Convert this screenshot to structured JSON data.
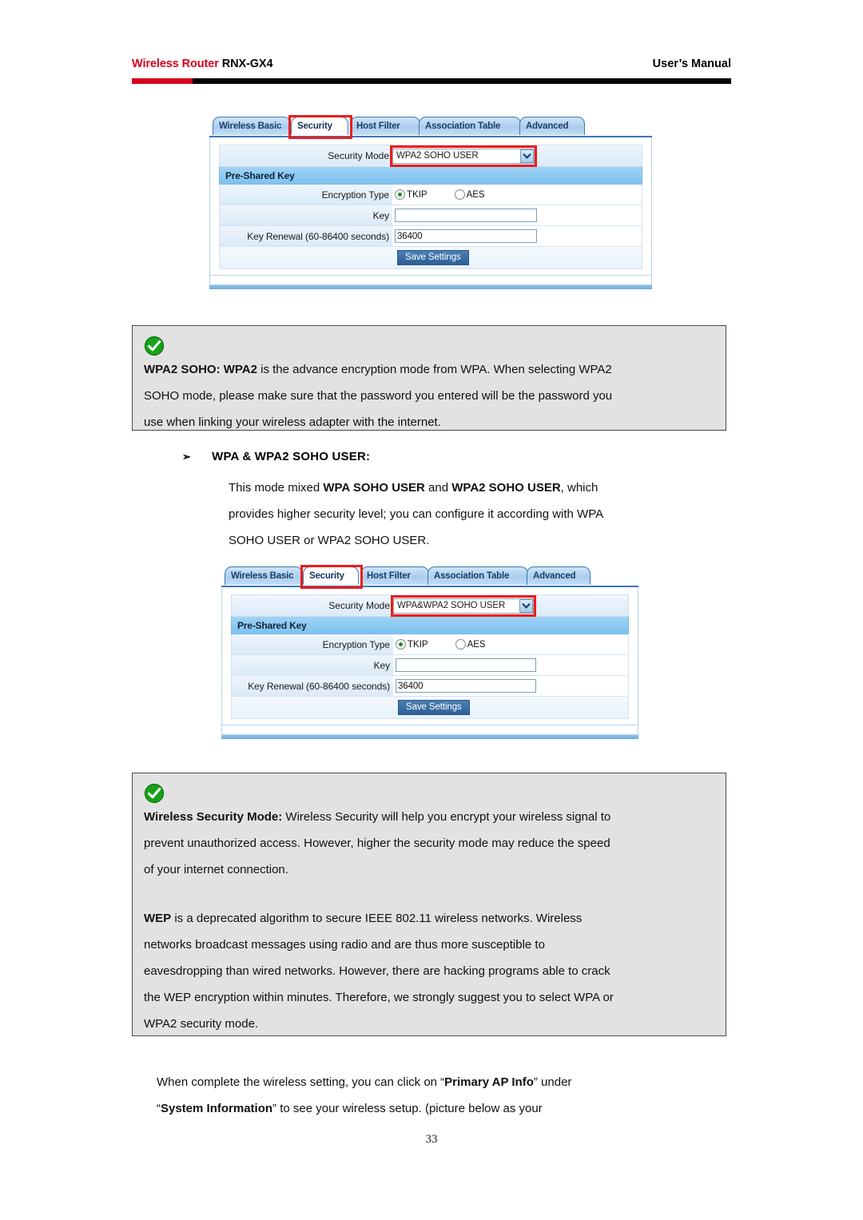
{
  "header": {
    "brand": "Wireless Router",
    "model": "RNX-GX4",
    "right": "User’s Manual"
  },
  "router_ui_1": {
    "tabs": [
      {
        "label": "Wireless Basic",
        "active": false
      },
      {
        "label": "Security",
        "active": true
      },
      {
        "label": "Host Filter",
        "active": false
      },
      {
        "label": "Association Table",
        "active": false
      },
      {
        "label": "Advanced",
        "active": false
      }
    ],
    "security_mode_label": "Security Mode",
    "security_mode_value": "WPA2 SOHO USER",
    "section_title": "Pre-Shared Key",
    "encryption_label": "Encryption Type",
    "encryption_options": [
      {
        "label": "TKIP",
        "selected": true
      },
      {
        "label": "AES",
        "selected": false
      }
    ],
    "key_label": "Key",
    "key_value": "",
    "renewal_label": "Key Renewal (60-86400 seconds)",
    "renewal_value": "36400",
    "save_label": "Save Settings"
  },
  "note_1": {
    "icon": "green-check-icon",
    "lines": [
      {
        "bold": "WPA2 SOHO: WPA2",
        "rest": " is the advance encryption mode from WPA. When selecting WPA2"
      },
      {
        "bold": "",
        "rest": "SOHO mode, please make sure that the password you entered will be the password you"
      },
      {
        "bold": "",
        "rest": "use when linking your wireless adapter with the internet."
      }
    ]
  },
  "section": {
    "arrow": "➢",
    "heading": "WPA & WPA2 SOHO USER:",
    "body_line1_a": "This mode mixed ",
    "body_line1_b": "WPA SOHO USER",
    "body_line1_c": " and ",
    "body_line1_d": "WPA2 SOHO USER",
    "body_line1_e": ", which",
    "body_line2": "provides higher security level; you can configure it according with WPA",
    "body_line3": "SOHO USER or WPA2 SOHO USER."
  },
  "router_ui_2": {
    "tabs": [
      {
        "label": "Wireless Basic",
        "active": false
      },
      {
        "label": "Security",
        "active": true
      },
      {
        "label": "Host Filter",
        "active": false
      },
      {
        "label": "Association Table",
        "active": false
      },
      {
        "label": "Advanced",
        "active": false
      }
    ],
    "security_mode_label": "Security Mode",
    "security_mode_value": "WPA&WPA2 SOHO USER",
    "section_title": "Pre-Shared Key",
    "encryption_label": "Encryption Type",
    "encryption_options": [
      {
        "label": "TKIP",
        "selected": true
      },
      {
        "label": "AES",
        "selected": false
      }
    ],
    "key_label": "Key",
    "key_value": "",
    "renewal_label": "Key Renewal (60-86400 seconds)",
    "renewal_value": "36400",
    "save_label": "Save Settings"
  },
  "note_2": {
    "icon": "green-check-icon",
    "p1_bold": "Wireless Security Mode:",
    "p1_l1": " Wireless Security will help you encrypt your wireless signal to",
    "p1_l2": "prevent unauthorized access. However, higher the security mode may reduce the speed",
    "p1_l3": "of your internet connection.",
    "p2_bold": "WEP",
    "p2_l1": " is a deprecated algorithm to secure IEEE 802.11 wireless networks. Wireless",
    "p2_l2": "networks broadcast messages using radio and are thus more susceptible to",
    "p2_l3": "eavesdropping than wired networks. However, there are hacking programs able to crack",
    "p2_l4": "the WEP encryption within minutes. Therefore, we strongly suggest you to select WPA or",
    "p2_l5": "WPA2 security mode."
  },
  "closing": {
    "l1_a": "When complete the wireless setting, you can click on “",
    "l1_b": "Primary AP Info",
    "l1_c": "” under",
    "l2_a": "“",
    "l2_b": "System Information",
    "l2_c": "” to see your wireless setup. (picture below as your"
  },
  "page_number": "33",
  "colors": {
    "brand_red": "#d6001c",
    "marker_red": "#ee1c1c",
    "tab_blue": "#aacdee",
    "psk_bar_blue": "#8dc9f2",
    "button_blue": "#2d5f95",
    "note_bg": "#e2e2e2",
    "check_green": "#1aa01a"
  }
}
